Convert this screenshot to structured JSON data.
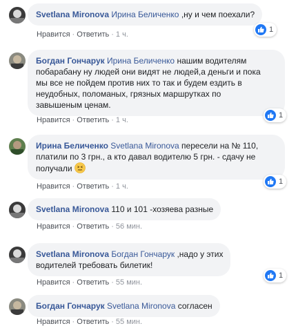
{
  "actions": {
    "like": "Нравится",
    "reply": "Ответить",
    "dot": "·"
  },
  "comments": [
    {
      "author": "Svetlana Mironova",
      "mention": "Ирина Беличенко",
      "text": " ,ну и чем поехали?",
      "time": "1 ч.",
      "reactions": "1"
    },
    {
      "author": "Богдан Гончарук",
      "mention": "Ирина Беличенко",
      "text_line1": " нашим водителям",
      "text_line2": "побарабану ну людей они видят не людей,а деньги и пока",
      "text_line3": "мы все не пойдем против них то так и будем ездить в",
      "text_line4": "неудобных, поломаных, грязных маршрутках по",
      "text_line5": "завышеным ценам.",
      "time": "1 ч.",
      "reactions": "1"
    },
    {
      "author": "Ирина Беличенко",
      "mention": "Svetlana Mironova",
      "text_line1": " пересели на № 110,",
      "text_line2": "платили по 3 грн., а кто давал водителю 5 грн. - сдачу не",
      "text_line3": "получали",
      "time": "1 ч.",
      "reactions": "1"
    },
    {
      "author": "Svetlana Mironova",
      "text": " 110 и 101 -хозяева разные",
      "time": "56 мин."
    },
    {
      "author": "Svetlana Mironova",
      "mention": "Богдан Гончарук",
      "text_line1": " ,надо у этих",
      "text_line2": "водителей требовать билетик!",
      "time": "55 мин.",
      "reactions": "1"
    },
    {
      "author": "Богдан Гончарук",
      "mention": "Svetlana Mironova",
      "text": " согласен",
      "time": "55 мин."
    }
  ]
}
